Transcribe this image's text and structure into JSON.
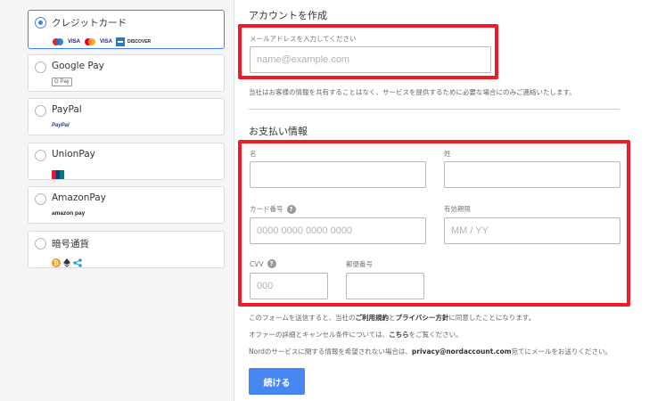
{
  "payment_methods": [
    {
      "label": "クレジットカード",
      "selected": true
    },
    {
      "label": "Google Pay",
      "selected": false,
      "logo": "G Pay"
    },
    {
      "label": "PayPal",
      "selected": false,
      "logo": "PayPal"
    },
    {
      "label": "UnionPay",
      "selected": false,
      "logo": "UnionPay"
    },
    {
      "label": "AmazonPay",
      "selected": false,
      "logo": "amazon pay"
    },
    {
      "label": "暗号通貨",
      "selected": false
    }
  ],
  "card_logos": [
    "VISA",
    "VISA",
    "DISCOVER"
  ],
  "account": {
    "heading": "アカウントを作成",
    "email_label": "メールアドレスを入力してください",
    "email_placeholder": "name@example.com",
    "privacy_note": "当社はお客様の情報を共有することはなく、サービスを提供するために必要な場合にのみご連絡いたします。"
  },
  "payment": {
    "heading": "お支払い情報",
    "first_name_label": "名",
    "last_name_label": "姓",
    "card_number_label": "カード番号",
    "card_number_placeholder": "0000 0000 0000 0000",
    "expiry_label": "有効期限",
    "expiry_placeholder": "MM / YY",
    "cvv_label": "CVV",
    "cvv_placeholder": "000",
    "postal_label": "郵便番号"
  },
  "footer": {
    "terms_pre": "このフォームを送信すると、当社の",
    "terms_link": "ご利用規約",
    "terms_mid": "と",
    "privacy_link": "プライバシー方針",
    "terms_post": "に同意したことになります。",
    "offer_pre": "オファーの詳細とキャンセル条件については、",
    "offer_link": "こちら",
    "offer_post": "をご覧ください。",
    "nord_pre": "Nordのサービスに関する情報を希望されない場合は、",
    "nord_email": "privacy@nordaccount.com",
    "nord_post": "宛てにメールをお送りください。"
  },
  "continue_label": "続ける",
  "colors": {
    "accent": "#4687f4",
    "highlight": "#ee1c25",
    "selected_border": "#3e82f7"
  }
}
